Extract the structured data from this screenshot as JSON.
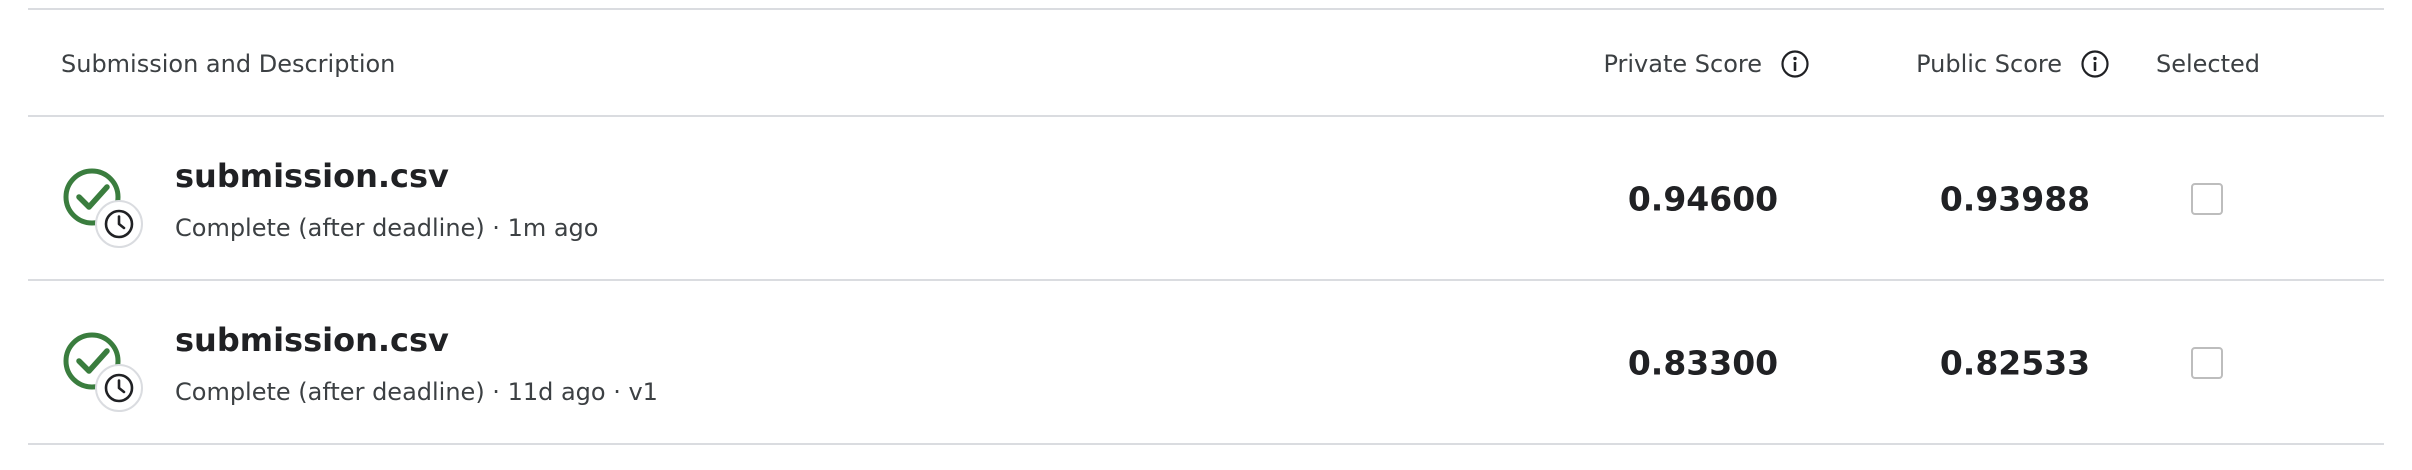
{
  "header": {
    "description_label": "Submission and Description",
    "private_score_label": "Private Score",
    "public_score_label": "Public Score",
    "selected_label": "Selected",
    "info_icon": "info-icon"
  },
  "submissions": [
    {
      "file_name": "submission.csv",
      "status": "Complete (after deadline) · 1m ago",
      "private_score": "0.94600",
      "public_score": "0.93988",
      "selected": false,
      "status_icon": "check-clock-icon"
    },
    {
      "file_name": "submission.csv",
      "status": "Complete (after deadline) · 11d ago · v1",
      "private_score": "0.83300",
      "public_score": "0.82533",
      "selected": false,
      "status_icon": "check-clock-icon"
    }
  ],
  "colors": {
    "success_green": "#3a7d3e",
    "divider": "#dadce0",
    "checkbox_border": "#bdbdbd"
  }
}
